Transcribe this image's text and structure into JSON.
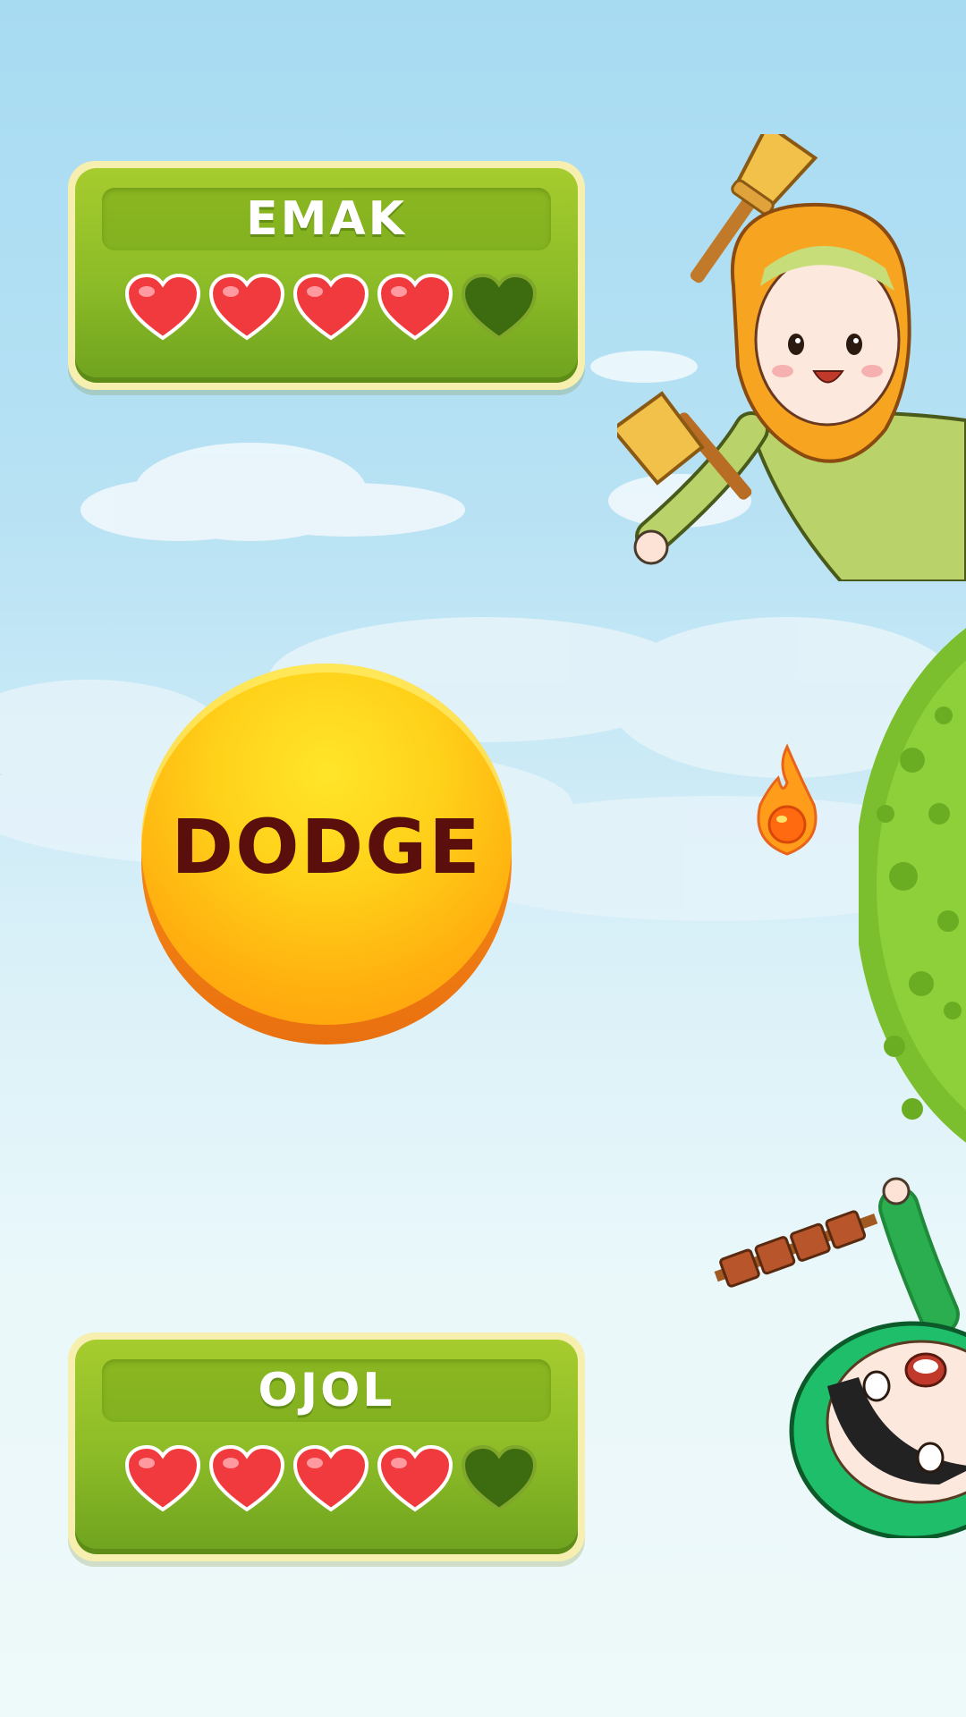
{
  "players": [
    {
      "name": "EMAK",
      "hearts_total": 5,
      "hearts_full": 4
    },
    {
      "name": "OJOL",
      "hearts_total": 5,
      "hearts_full": 4
    }
  ],
  "dodge_button": {
    "label": "DODGE"
  },
  "colors": {
    "panel_border": "#f6efb0",
    "panel_fill": "#8bbb27",
    "heart_full": "#f03a3e",
    "heart_empty": "#3d6b10",
    "dodge_face": "#ffc81a",
    "dodge_text": "#5a0f0c",
    "tree_green": "#7cbf2e"
  },
  "icons": {
    "heart_full": "heart-full-icon",
    "heart_empty": "heart-empty-icon",
    "fireball": "fireball-icon"
  }
}
